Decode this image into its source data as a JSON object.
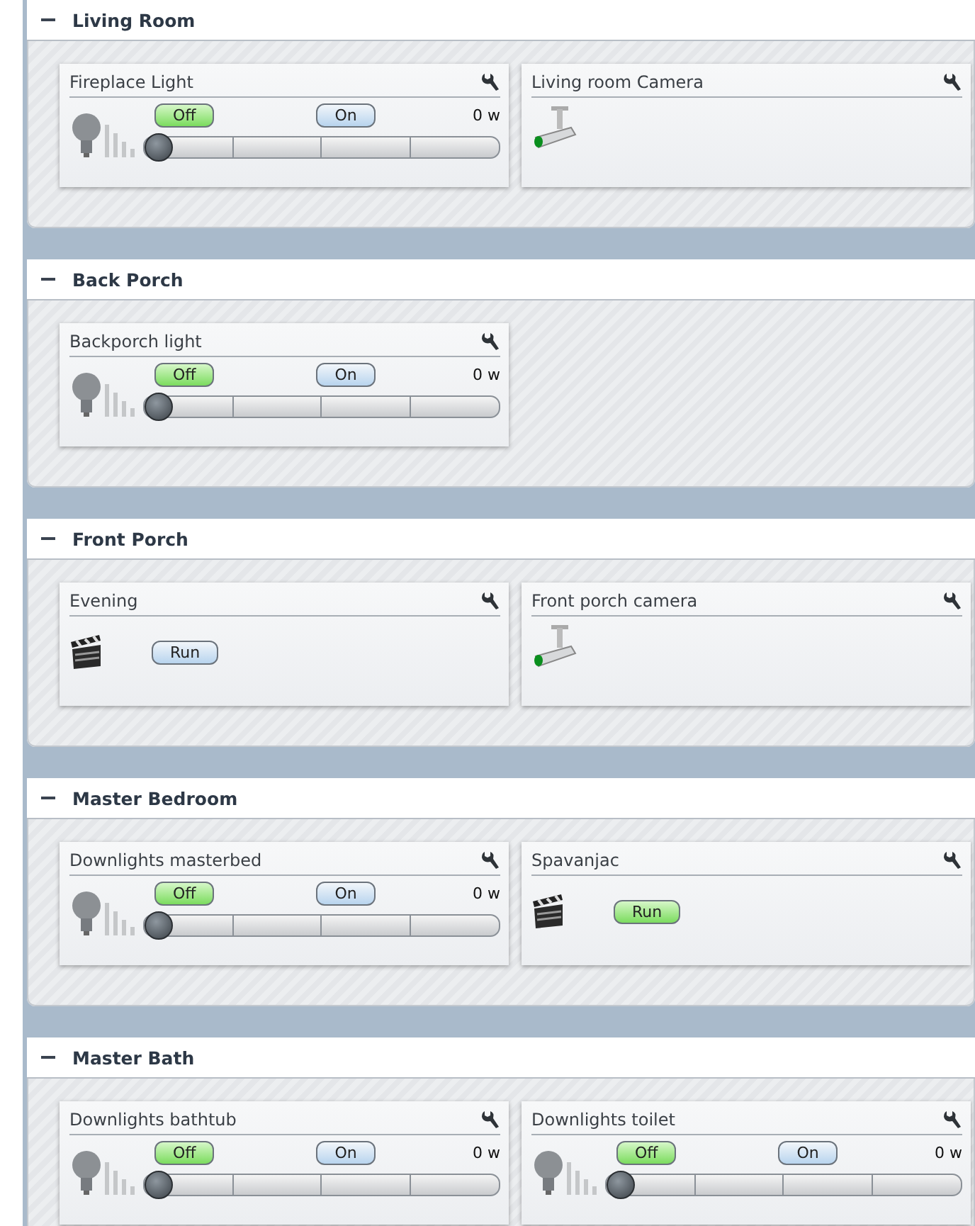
{
  "rooms": [
    {
      "name": "Living Room",
      "expanded": true,
      "devices": [
        {
          "kind": "light",
          "name": "Fireplace Light",
          "off_label": "Off",
          "on_label": "On",
          "on": false,
          "power": "0 w",
          "level": 0
        },
        {
          "kind": "camera",
          "name": "Living room Camera"
        }
      ]
    },
    {
      "name": "Back Porch",
      "expanded": true,
      "devices": [
        {
          "kind": "light",
          "name": "Backporch light",
          "off_label": "Off",
          "on_label": "On",
          "on": false,
          "power": "0 w",
          "level": 0
        }
      ]
    },
    {
      "name": "Front Porch",
      "expanded": true,
      "devices": [
        {
          "kind": "scene",
          "name": "Evening",
          "run_label": "Run",
          "active": false
        },
        {
          "kind": "camera",
          "name": "Front porch camera"
        }
      ]
    },
    {
      "name": "Master Bedroom",
      "expanded": true,
      "devices": [
        {
          "kind": "light",
          "name": "Downlights masterbed",
          "off_label": "Off",
          "on_label": "On",
          "on": false,
          "power": "0 w",
          "level": 0
        },
        {
          "kind": "scene",
          "name": "Spavanjac",
          "run_label": "Run",
          "active": true
        }
      ]
    },
    {
      "name": "Master Bath",
      "expanded": true,
      "devices": [
        {
          "kind": "light",
          "name": "Downlights bathtub",
          "off_label": "Off",
          "on_label": "On",
          "on": false,
          "power": "0 w",
          "level": 0
        },
        {
          "kind": "light",
          "name": "Downlights toilet",
          "off_label": "Off",
          "on_label": "On",
          "on": false,
          "power": "0 w",
          "level": 0
        }
      ]
    }
  ]
}
